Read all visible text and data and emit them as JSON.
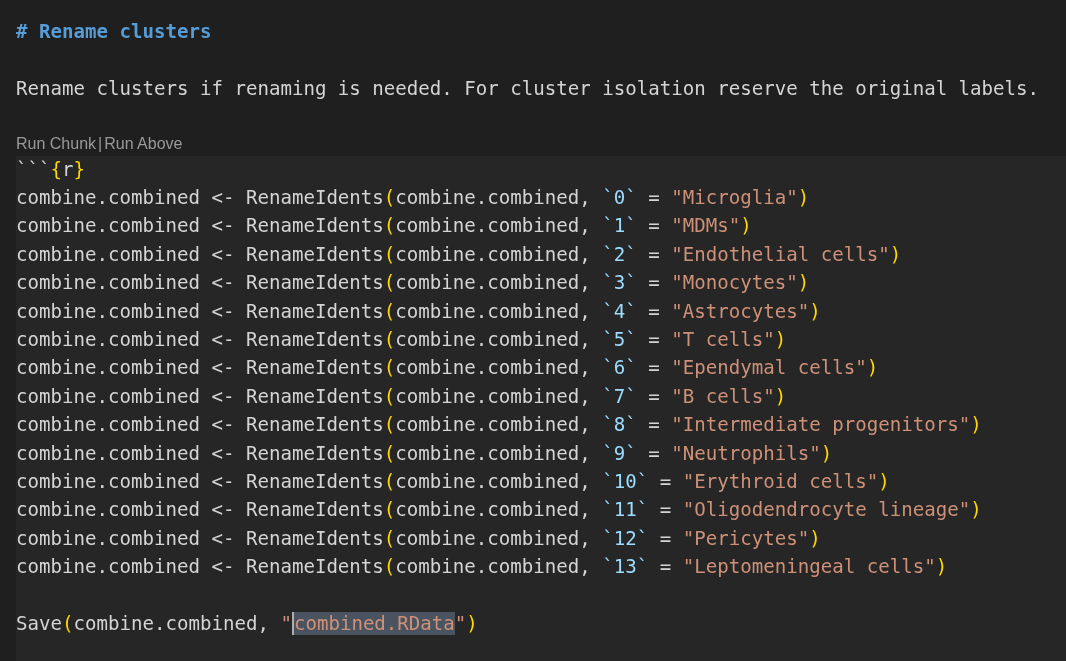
{
  "heading": "# Rename clusters",
  "paragraph": "Rename clusters if renaming is needed. For cluster isolation reserve the original labels.",
  "code_lens": [
    {
      "label": "Run Chunk"
    },
    {
      "label": "Run Above"
    }
  ],
  "code_lens_separator": "|",
  "chunk_lines": [
    [
      {
        "kind": "plain",
        "text": "```"
      },
      {
        "kind": "bracket",
        "text": "{"
      },
      {
        "kind": "plain",
        "text": "r"
      },
      {
        "kind": "bracket",
        "text": "}"
      }
    ],
    [
      {
        "kind": "plain",
        "text": "combine.combined <- RenameIdents"
      },
      {
        "kind": "bracket",
        "text": "("
      },
      {
        "kind": "plain",
        "text": "combine.combined, "
      },
      {
        "kind": "ident",
        "text": "`0`"
      },
      {
        "kind": "plain",
        "text": " = "
      },
      {
        "kind": "string",
        "text": "\"Microglia\""
      },
      {
        "kind": "bracket",
        "text": ")"
      }
    ],
    [
      {
        "kind": "plain",
        "text": "combine.combined <- RenameIdents"
      },
      {
        "kind": "bracket",
        "text": "("
      },
      {
        "kind": "plain",
        "text": "combine.combined, "
      },
      {
        "kind": "ident",
        "text": "`1`"
      },
      {
        "kind": "plain",
        "text": " = "
      },
      {
        "kind": "string",
        "text": "\"MDMs\""
      },
      {
        "kind": "bracket",
        "text": ")"
      }
    ],
    [
      {
        "kind": "plain",
        "text": "combine.combined <- RenameIdents"
      },
      {
        "kind": "bracket",
        "text": "("
      },
      {
        "kind": "plain",
        "text": "combine.combined, "
      },
      {
        "kind": "ident",
        "text": "`2`"
      },
      {
        "kind": "plain",
        "text": " = "
      },
      {
        "kind": "string",
        "text": "\"Endothelial cells\""
      },
      {
        "kind": "bracket",
        "text": ")"
      }
    ],
    [
      {
        "kind": "plain",
        "text": "combine.combined <- RenameIdents"
      },
      {
        "kind": "bracket",
        "text": "("
      },
      {
        "kind": "plain",
        "text": "combine.combined, "
      },
      {
        "kind": "ident",
        "text": "`3`"
      },
      {
        "kind": "plain",
        "text": " = "
      },
      {
        "kind": "string",
        "text": "\"Monocytes\""
      },
      {
        "kind": "bracket",
        "text": ")"
      }
    ],
    [
      {
        "kind": "plain",
        "text": "combine.combined <- RenameIdents"
      },
      {
        "kind": "bracket",
        "text": "("
      },
      {
        "kind": "plain",
        "text": "combine.combined, "
      },
      {
        "kind": "ident",
        "text": "`4`"
      },
      {
        "kind": "plain",
        "text": " = "
      },
      {
        "kind": "string",
        "text": "\"Astrocytes\""
      },
      {
        "kind": "bracket",
        "text": ")"
      }
    ],
    [
      {
        "kind": "plain",
        "text": "combine.combined <- RenameIdents"
      },
      {
        "kind": "bracket",
        "text": "("
      },
      {
        "kind": "plain",
        "text": "combine.combined, "
      },
      {
        "kind": "ident",
        "text": "`5`"
      },
      {
        "kind": "plain",
        "text": " = "
      },
      {
        "kind": "string",
        "text": "\"T cells\""
      },
      {
        "kind": "bracket",
        "text": ")"
      }
    ],
    [
      {
        "kind": "plain",
        "text": "combine.combined <- RenameIdents"
      },
      {
        "kind": "bracket",
        "text": "("
      },
      {
        "kind": "plain",
        "text": "combine.combined, "
      },
      {
        "kind": "ident",
        "text": "`6`"
      },
      {
        "kind": "plain",
        "text": " = "
      },
      {
        "kind": "string",
        "text": "\"Ependymal cells\""
      },
      {
        "kind": "bracket",
        "text": ")"
      }
    ],
    [
      {
        "kind": "plain",
        "text": "combine.combined <- RenameIdents"
      },
      {
        "kind": "bracket",
        "text": "("
      },
      {
        "kind": "plain",
        "text": "combine.combined, "
      },
      {
        "kind": "ident",
        "text": "`7`"
      },
      {
        "kind": "plain",
        "text": " = "
      },
      {
        "kind": "string",
        "text": "\"B cells\""
      },
      {
        "kind": "bracket",
        "text": ")"
      }
    ],
    [
      {
        "kind": "plain",
        "text": "combine.combined <- RenameIdents"
      },
      {
        "kind": "bracket",
        "text": "("
      },
      {
        "kind": "plain",
        "text": "combine.combined, "
      },
      {
        "kind": "ident",
        "text": "`8`"
      },
      {
        "kind": "plain",
        "text": " = "
      },
      {
        "kind": "string",
        "text": "\"Intermediate progenitors\""
      },
      {
        "kind": "bracket",
        "text": ")"
      }
    ],
    [
      {
        "kind": "plain",
        "text": "combine.combined <- RenameIdents"
      },
      {
        "kind": "bracket",
        "text": "("
      },
      {
        "kind": "plain",
        "text": "combine.combined, "
      },
      {
        "kind": "ident",
        "text": "`9`"
      },
      {
        "kind": "plain",
        "text": " = "
      },
      {
        "kind": "string",
        "text": "\"Neutrophils\""
      },
      {
        "kind": "bracket",
        "text": ")"
      }
    ],
    [
      {
        "kind": "plain",
        "text": "combine.combined <- RenameIdents"
      },
      {
        "kind": "bracket",
        "text": "("
      },
      {
        "kind": "plain",
        "text": "combine.combined, "
      },
      {
        "kind": "ident",
        "text": "`10`"
      },
      {
        "kind": "plain",
        "text": " = "
      },
      {
        "kind": "string",
        "text": "\"Erythroid cells\""
      },
      {
        "kind": "bracket",
        "text": ")"
      }
    ],
    [
      {
        "kind": "plain",
        "text": "combine.combined <- RenameIdents"
      },
      {
        "kind": "bracket",
        "text": "("
      },
      {
        "kind": "plain",
        "text": "combine.combined, "
      },
      {
        "kind": "ident",
        "text": "`11`"
      },
      {
        "kind": "plain",
        "text": " = "
      },
      {
        "kind": "string",
        "text": "\"Oligodendrocyte lineage\""
      },
      {
        "kind": "bracket",
        "text": ")"
      }
    ],
    [
      {
        "kind": "plain",
        "text": "combine.combined <- RenameIdents"
      },
      {
        "kind": "bracket",
        "text": "("
      },
      {
        "kind": "plain",
        "text": "combine.combined, "
      },
      {
        "kind": "ident",
        "text": "`12`"
      },
      {
        "kind": "plain",
        "text": " = "
      },
      {
        "kind": "string",
        "text": "\"Pericytes\""
      },
      {
        "kind": "bracket",
        "text": ")"
      }
    ],
    [
      {
        "kind": "plain",
        "text": "combine.combined <- RenameIdents"
      },
      {
        "kind": "bracket",
        "text": "("
      },
      {
        "kind": "plain",
        "text": "combine.combined, "
      },
      {
        "kind": "ident",
        "text": "`13`"
      },
      {
        "kind": "plain",
        "text": " = "
      },
      {
        "kind": "string",
        "text": "\"Leptomeningeal cells\""
      },
      {
        "kind": "bracket",
        "text": ")"
      }
    ],
    {
      "kind": "blank"
    },
    [
      {
        "kind": "plain",
        "text": "Save"
      },
      {
        "kind": "bracket",
        "text": "("
      },
      {
        "kind": "plain",
        "text": "combine.combined, "
      },
      {
        "kind": "string",
        "text": "\""
      },
      {
        "kind": "string",
        "text": "combined.RData",
        "selected": true
      },
      {
        "kind": "string",
        "text": "\""
      },
      {
        "kind": "bracket",
        "text": ")"
      }
    ]
  ]
}
